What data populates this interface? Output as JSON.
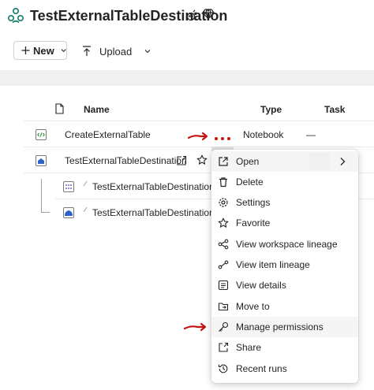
{
  "workspace": {
    "title": "TestExternalTableDestination"
  },
  "toolbar": {
    "new_label": "New",
    "upload_label": "Upload"
  },
  "table": {
    "headers": {
      "name": "Name",
      "type": "Type",
      "task": "Task"
    },
    "rows": [
      {
        "name": "CreateExternalTable",
        "type": "Notebook",
        "task": "—"
      },
      {
        "name": "TestExternalTableDestination",
        "type": "",
        "task": ""
      },
      {
        "name": "TestExternalTableDestination",
        "type": "",
        "task": ""
      },
      {
        "name": "TestExternalTableDestination",
        "type": "",
        "task": ""
      }
    ]
  },
  "context_menu": {
    "items": [
      {
        "label": "Open",
        "icon": "open-external-icon"
      },
      {
        "label": "Delete",
        "icon": "trash-icon"
      },
      {
        "label": "Settings",
        "icon": "gear-icon"
      },
      {
        "label": "Favorite",
        "icon": "star-icon"
      },
      {
        "label": "View workspace lineage",
        "icon": "lineage-icon"
      },
      {
        "label": "View item lineage",
        "icon": "item-lineage-icon"
      },
      {
        "label": "View details",
        "icon": "details-icon"
      },
      {
        "label": "Move to",
        "icon": "move-folder-icon"
      },
      {
        "label": "Manage permissions",
        "icon": "key-icon"
      },
      {
        "label": "Share",
        "icon": "share-icon"
      },
      {
        "label": "Recent runs",
        "icon": "history-icon"
      }
    ]
  },
  "colors": {
    "annotation_red": "#c41313",
    "lakehouse_blue": "#2f62c9",
    "highlight_grey": "#f5f5f5"
  }
}
